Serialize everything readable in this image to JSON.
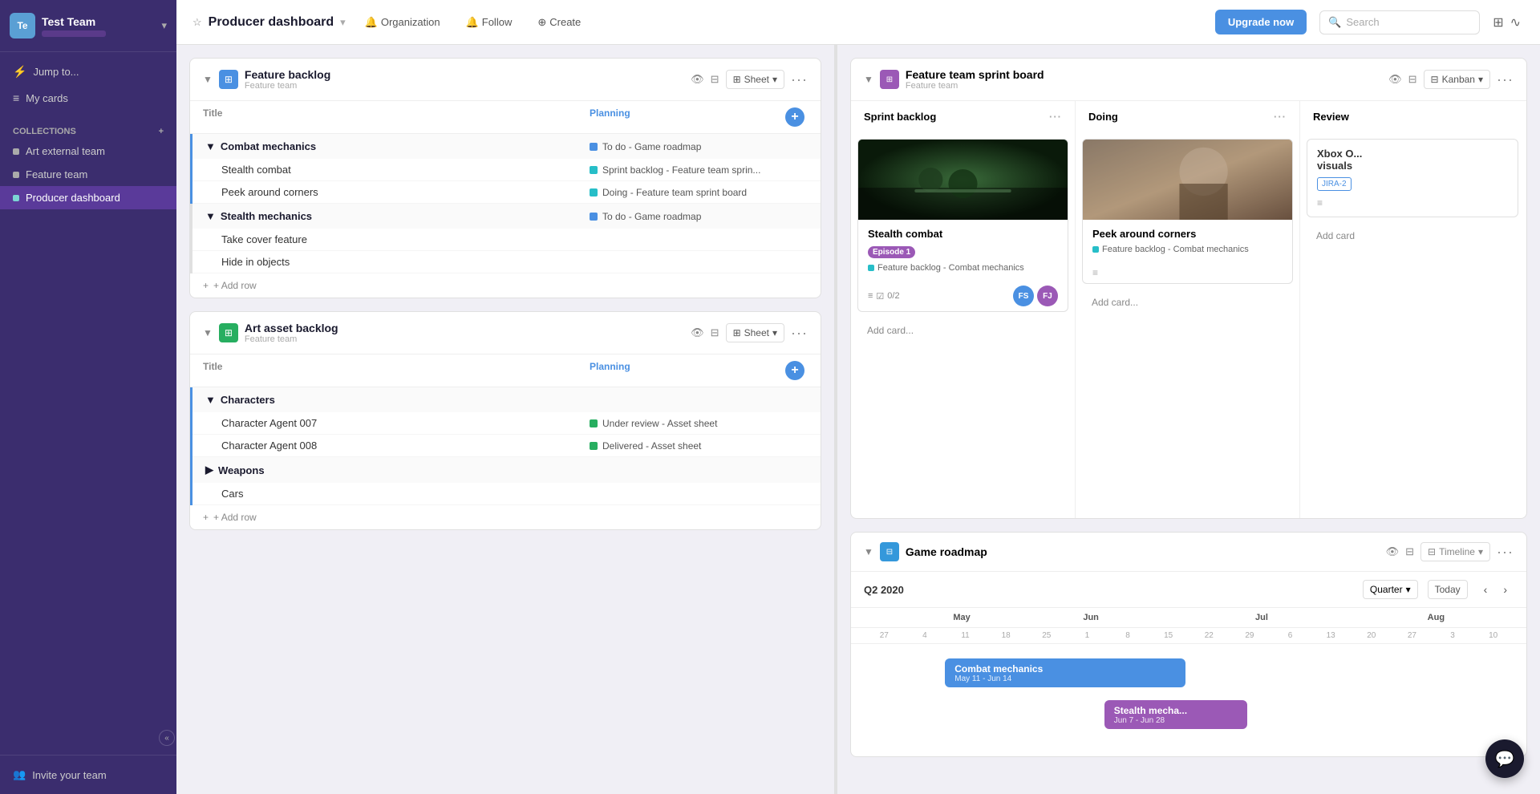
{
  "sidebar": {
    "team_avatar": "Te",
    "team_name": "Test Team",
    "team_name_sub": "········",
    "collapse_icon": "«",
    "nav_items": [
      {
        "id": "jump-to",
        "label": "Jump to...",
        "icon": "⚡"
      },
      {
        "id": "my-cards",
        "label": "My cards",
        "icon": "≡"
      }
    ],
    "collections_label": "Collections",
    "add_icon": "+",
    "collection_items": [
      {
        "id": "art-external",
        "label": "Art external team",
        "active": false
      },
      {
        "id": "feature-team",
        "label": "Feature team",
        "active": false
      },
      {
        "id": "producer-dashboard",
        "label": "Producer dashboard",
        "active": true
      }
    ],
    "invite_label": "Invite your team",
    "invite_icon": "👥"
  },
  "topbar": {
    "star_icon": "☆",
    "org_label": "Organization",
    "bell_icon": "🔔",
    "follow_label": "Follow",
    "plus_icon": "⊕",
    "create_label": "Create",
    "upgrade_label": "Upgrade now",
    "search_placeholder": "Search",
    "grid_icon": "⊞",
    "activity_icon": "∿",
    "breadcrumb": "Producer dashboard",
    "chevron": "∨"
  },
  "feature_backlog": {
    "title": "Feature backlog",
    "subtitle": "Feature team",
    "col_title": "Title",
    "col_planning": "Planning",
    "view_label": "Sheet",
    "groups": [
      {
        "id": "combat-mechanics",
        "title": "Combat mechanics",
        "border_color": "#4a90e2",
        "rows": [
          {
            "title": "Stealth combat",
            "planning": "Sprint backlog - Feature team sprin...",
            "dot": "dot-cyan"
          },
          {
            "title": "Peek around corners",
            "planning": "Doing - Feature team sprint board",
            "dot": "dot-cyan"
          }
        ]
      },
      {
        "id": "stealth-mechanics",
        "title": "Stealth mechanics",
        "border_color": "#e0e0e0",
        "rows": [
          {
            "title": "Take cover feature",
            "planning": "",
            "dot": ""
          },
          {
            "title": "Hide in objects",
            "planning": "",
            "dot": ""
          }
        ]
      }
    ],
    "add_row": "+ Add row",
    "planning_dots": {
      "sprint_backlog": "dot-cyan",
      "doing": "dot-cyan",
      "todo": "dot-blue"
    }
  },
  "art_asset_backlog": {
    "title": "Art asset backlog",
    "subtitle": "Feature team",
    "col_title": "Title",
    "col_planning": "Planning",
    "view_label": "Sheet",
    "groups": [
      {
        "id": "characters",
        "title": "Characters",
        "border_color": "#4a90e2",
        "rows": [
          {
            "title": "Character Agent 007",
            "planning": "Under review - Asset sheet",
            "dot": "dot-green"
          },
          {
            "title": "Character Agent 008",
            "planning": "Delivered - Asset sheet",
            "dot": "dot-green"
          }
        ]
      },
      {
        "id": "weapons",
        "title": "Weapons",
        "border_color": "#e0e0e0",
        "rows": [
          {
            "title": "Cars",
            "planning": "",
            "dot": ""
          }
        ]
      }
    ],
    "add_row": "+ Add row"
  },
  "feature_sprint_board": {
    "title": "Feature team sprint board",
    "subtitle": "Feature team",
    "view_label": "Kanban",
    "columns": [
      {
        "id": "sprint-backlog",
        "title": "Sprint backlog",
        "cards": [
          {
            "title": "Stealth combat",
            "has_img": true,
            "img_type": "forest",
            "tag": "Episode 1",
            "ref": "Feature backlog - Combat mechanics",
            "checklist": "0/2",
            "avatars": [
              "FS",
              "FJ"
            ]
          }
        ],
        "add_card": "Add card..."
      },
      {
        "id": "doing",
        "title": "Doing",
        "cards": [
          {
            "title": "Peek around corners",
            "has_img": true,
            "img_type": "soldier",
            "ref": "Feature backlog - Combat mechanics",
            "checklist": "",
            "avatars": []
          }
        ],
        "add_card": "Add card..."
      },
      {
        "id": "review",
        "title": "Review",
        "cards": [
          {
            "title": "Xbox O... visuals",
            "has_img": false,
            "partial": true,
            "tag": "JIRA-2",
            "tag_style": "outline"
          }
        ],
        "add_card": "Add card"
      }
    ]
  },
  "game_roadmap": {
    "title": "Game roadmap",
    "view_label": "Timeline",
    "period": "Q2 2020",
    "quarter_select": "Quarter",
    "today_label": "Today",
    "months": [
      {
        "label": "May",
        "dates": [
          "27",
          "4",
          "11",
          "18",
          "25"
        ]
      },
      {
        "label": "Jun",
        "dates": [
          "1",
          "8",
          "15",
          "22",
          "29"
        ]
      },
      {
        "label": "Jul",
        "dates": [
          "6",
          "13",
          "20",
          "27"
        ]
      },
      {
        "label": "Aug",
        "dates": [
          "3",
          "10"
        ]
      }
    ],
    "date_row": [
      "27",
      "4",
      "11",
      "18",
      "25",
      "1",
      "8",
      "15",
      "22",
      "29",
      "6",
      "13",
      "20",
      "27",
      "3",
      "10"
    ],
    "bars": [
      {
        "id": "combat-mechanics",
        "title": "Combat mechanics",
        "subtitle": "May 11 - Jun 14",
        "color": "bar-blue",
        "left_pct": 12,
        "width_pct": 38
      },
      {
        "id": "stealth-mechanics",
        "title": "Stealth mecha...",
        "subtitle": "Jun 7 - Jun 28",
        "color": "bar-purple",
        "left_pct": 32,
        "width_pct": 25
      }
    ]
  },
  "icons": {
    "collapse": "▼",
    "expand": "▶",
    "more": "···",
    "filter": "⊟",
    "eye": "👁",
    "chat": "💬",
    "check": "☑"
  }
}
